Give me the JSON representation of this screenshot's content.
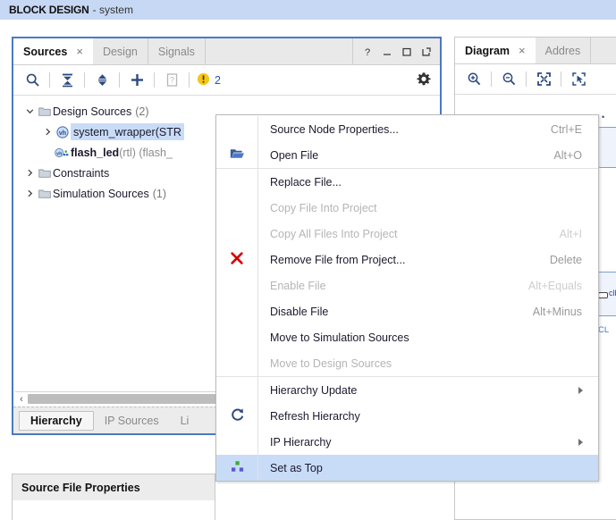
{
  "banner": {
    "title": "BLOCK DESIGN",
    "subtitle": "- system"
  },
  "sources_panel": {
    "tabs": [
      {
        "label": "Sources",
        "active": true,
        "close": "×"
      },
      {
        "label": "Design",
        "active": false
      },
      {
        "label": "Signals",
        "active": false
      }
    ],
    "window_controls": [
      {
        "name": "help-icon",
        "glyph": "?"
      },
      {
        "name": "minimize-icon",
        "glyph": "—"
      },
      {
        "name": "maximize-icon",
        "glyph": "□"
      },
      {
        "name": "float-icon",
        "glyph": "↗"
      }
    ],
    "toolbar": {
      "search_icon": "search-icon",
      "collapse_icon": "collapse-all-icon",
      "expand_icon": "expand-all-icon",
      "add_icon": "add-sources-icon",
      "report_icon": "report-icon",
      "warning_icon": "warning-icon",
      "warning_count": "2",
      "settings_icon": "gear-icon"
    },
    "tree": [
      {
        "label": "Design Sources",
        "count": "(2)",
        "indent": 0,
        "expanded": true,
        "icon": "folder-icon"
      },
      {
        "label": "system_wrapper(STR",
        "count": "",
        "indent": 1,
        "expanded": false,
        "icon": "vhdl-icon",
        "selected": true
      },
      {
        "label": "flash_led",
        "suffix": "(rtl) (flash_",
        "count": "",
        "indent": 1,
        "leaf": true,
        "icon": "vhdl-module-icon"
      },
      {
        "label": "Constraints",
        "count": "",
        "indent": 0,
        "expanded": false,
        "icon": "folder-icon"
      },
      {
        "label": "Simulation Sources",
        "count": "(1)",
        "indent": 0,
        "expanded": false,
        "icon": "folder-icon"
      }
    ],
    "hscroll": {
      "left_arrow": "‹"
    },
    "bottom_tabs": [
      {
        "label": "Hierarchy",
        "active": true
      },
      {
        "label": "IP Sources",
        "active": false
      },
      {
        "label": "Li",
        "active": false
      }
    ]
  },
  "source_file_properties": {
    "title": "Source File Properties"
  },
  "diagram_panel": {
    "tabs": [
      {
        "label": "Diagram",
        "active": true,
        "close": "×"
      },
      {
        "label": "Addres",
        "active": false
      }
    ],
    "toolbar": [
      {
        "name": "zoom-in-icon"
      },
      {
        "name": "zoom-out-icon"
      },
      {
        "name": "zoom-fit-icon"
      },
      {
        "name": "zoom-area-icon"
      }
    ],
    "canvas": {
      "port_label": "clk",
      "net_label": "CL"
    }
  },
  "context_menu": {
    "items": [
      {
        "label": "Source Node Properties...",
        "accel": "Ctrl+E",
        "disabled": false,
        "icon": "",
        "submenu": false
      },
      {
        "label": "Open File",
        "accel": "Alt+O",
        "disabled": false,
        "icon": "open-folder-icon",
        "submenu": false
      },
      {
        "separator": true
      },
      {
        "label": "Replace File...",
        "accel": "",
        "disabled": false,
        "icon": "",
        "submenu": false
      },
      {
        "label": "Copy File Into Project",
        "accel": "",
        "disabled": true,
        "icon": "",
        "submenu": false
      },
      {
        "label": "Copy All Files Into Project",
        "accel": "Alt+I",
        "disabled": true,
        "icon": "",
        "submenu": false
      },
      {
        "label": "Remove File from Project...",
        "accel": "Delete",
        "disabled": false,
        "icon": "remove-x-icon",
        "submenu": false
      },
      {
        "label": "Enable File",
        "accel": "Alt+Equals",
        "disabled": true,
        "icon": "",
        "submenu": false
      },
      {
        "label": "Disable File",
        "accel": "Alt+Minus",
        "disabled": false,
        "icon": "",
        "submenu": false
      },
      {
        "label": "Move to Simulation Sources",
        "accel": "",
        "disabled": false,
        "icon": "",
        "submenu": false
      },
      {
        "label": "Move to Design Sources",
        "accel": "",
        "disabled": true,
        "icon": "",
        "submenu": false
      },
      {
        "separator": true
      },
      {
        "label": "Hierarchy Update",
        "accel": "",
        "disabled": false,
        "icon": "",
        "submenu": true
      },
      {
        "label": "Refresh Hierarchy",
        "accel": "",
        "disabled": false,
        "icon": "refresh-icon",
        "submenu": false
      },
      {
        "label": "IP Hierarchy",
        "accel": "",
        "disabled": false,
        "icon": "",
        "submenu": true
      },
      {
        "label": "Set as Top",
        "accel": "",
        "disabled": false,
        "icon": "set-as-top-icon",
        "submenu": false,
        "highlight": true
      }
    ]
  },
  "colors": {
    "banner_bg": "#c7d8f5",
    "panel_border_active": "#4a79c4",
    "selection": "#c9dcf7",
    "icon_blue": "#2c4a80",
    "warning_yellow": "#f5c518",
    "remove_red": "#d40000",
    "link_blue": "#1a56c4"
  }
}
